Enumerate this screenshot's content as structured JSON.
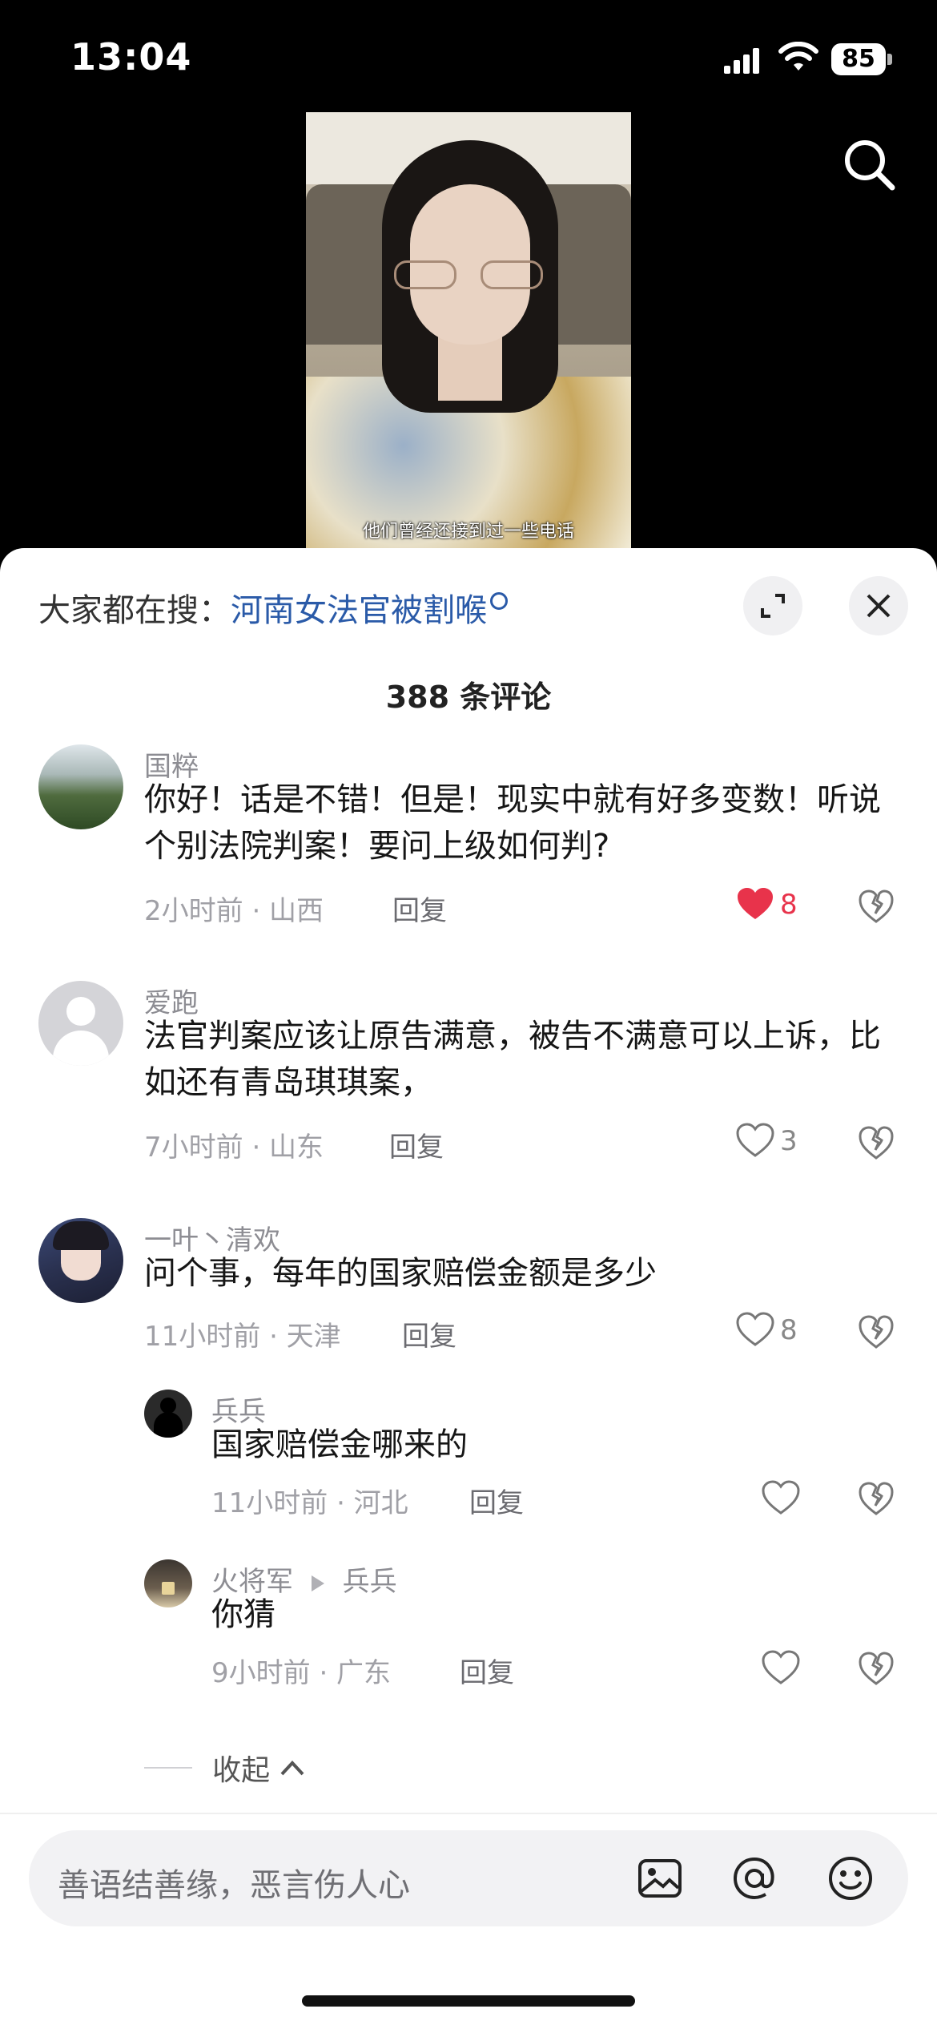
{
  "status_bar": {
    "time": "13:04",
    "battery": "85"
  },
  "video": {
    "subtitle": "他们曾经还接到过一些电话"
  },
  "sheet": {
    "hot_search_prefix": "大家都在搜：",
    "hot_search_link": "河南女法官被割喉",
    "comment_count": "388 条评论",
    "collapse_label": "收起"
  },
  "comments": [
    {
      "user": "国粹",
      "text": "你好！话是不错！但是！现实中就有好多变数！听说个别法院判案！要问上级如何判?",
      "meta": "2小时前 · 山西",
      "reply": "回复",
      "likes": "8",
      "liked": true
    },
    {
      "user": "爱跑",
      "text": "法官判案应该让原告满意，被告不满意可以上诉，比如还有青岛琪琪案，",
      "meta": "7小时前 · 山东",
      "reply": "回复",
      "likes": "3",
      "liked": false
    },
    {
      "user": "一叶丶清欢",
      "text": "问个事，每年的国家赔偿金额是多少",
      "meta": "11小时前 · 天津",
      "reply": "回复",
      "likes": "8",
      "liked": false
    }
  ],
  "replies": [
    {
      "user": "兵兵",
      "text": "国家赔偿金哪来的",
      "meta": "11小时前 · 河北",
      "reply": "回复",
      "likes": ""
    },
    {
      "user": "火将军",
      "reply_to": "兵兵",
      "text": "你猜",
      "meta": "9小时前 · 广东",
      "reply": "回复",
      "likes": ""
    }
  ],
  "input": {
    "placeholder": "善语结善缘，恶言伤人心"
  },
  "icons": [
    "search-icon",
    "expand-icon",
    "close-icon",
    "heart-icon",
    "dislike-icon",
    "image-icon",
    "at-icon",
    "emoji-icon"
  ],
  "colors": {
    "accent_red": "#e8334b",
    "link_blue": "#2a5aa8"
  }
}
